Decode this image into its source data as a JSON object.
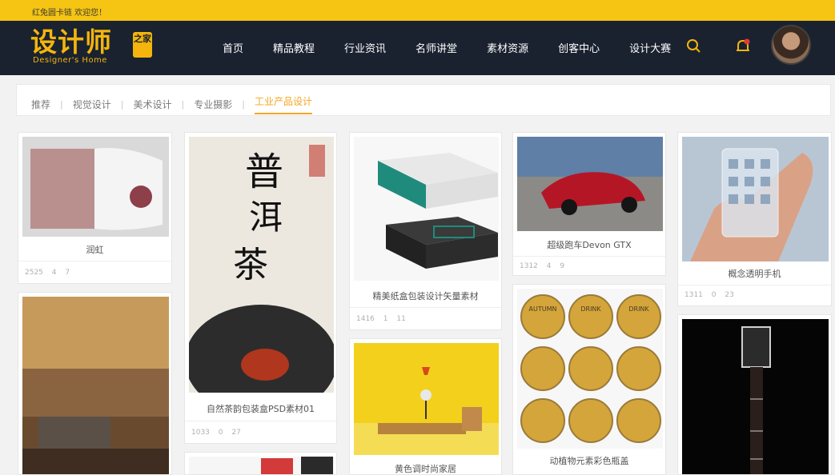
{
  "topbar": {
    "welcome": "红兔圆卡链 欢迎您！"
  },
  "logo": {
    "main": "设计师",
    "sub": "Designer's Home",
    "badge": "之家"
  },
  "nav": [
    "首页",
    "精品教程",
    "行业资讯",
    "名师讲堂",
    "素材资源",
    "创客中心",
    "设计大赛"
  ],
  "header_icons": {
    "search": "search-icon",
    "notifications": "bell-icon"
  },
  "categories": [
    "推荐",
    "视觉设计",
    "美术设计",
    "专业摄影",
    "工业产品设计"
  ],
  "active_category": "工业产品设计",
  "accent_color": "#f5a623",
  "cards": {
    "c1": {
      "title": "润虹",
      "views": "2525",
      "likes": "4",
      "comments": "7"
    },
    "c2": {
      "title": "",
      "views": "",
      "likes": "",
      "comments": ""
    },
    "c3": {
      "title": "自然茶韵包装盒PSD素材01",
      "views": "1033",
      "likes": "0",
      "comments": "27",
      "art_text": "普洱茶"
    },
    "c4": {
      "title": "",
      "views": "",
      "likes": "",
      "comments": ""
    },
    "c5": {
      "title": "精美纸盒包装设计矢量素材",
      "views": "1416",
      "likes": "1",
      "comments": "11"
    },
    "c6": {
      "title": "黄色调时尚家居",
      "views": "",
      "likes": "",
      "comments": ""
    },
    "c7": {
      "title": "超级跑车Devon GTX",
      "views": "1312",
      "likes": "4",
      "comments": "9"
    },
    "c8": {
      "title": "动植物元素彩色瓶盖",
      "views": "",
      "likes": "",
      "comments": ""
    },
    "c9": {
      "title": "概念透明手机",
      "views": "1311",
      "likes": "0",
      "comments": "23"
    },
    "c10": {
      "title": "",
      "views": "",
      "likes": "",
      "comments": ""
    }
  },
  "bottle_cap_label": "AUTUMN",
  "bottle_cap_label_2": "DRINK"
}
